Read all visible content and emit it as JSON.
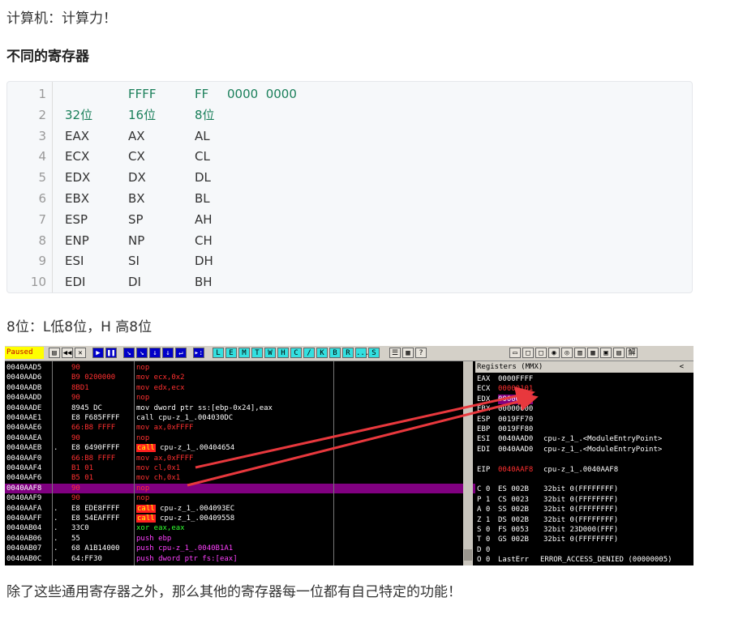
{
  "intro": "计算机：计算力！",
  "heading": "不同的寄存器",
  "code": {
    "line_numbers": [
      "1",
      "2",
      "3",
      "4",
      "5",
      "6",
      "7",
      "8",
      "9",
      "10"
    ],
    "rows": [
      {
        "c1": "",
        "c2": "FFFF",
        "c3": "FF",
        "c4": "0000  0000"
      },
      {
        "c1": "32位",
        "c2": "16位",
        "c3": "8位",
        "c4": ""
      },
      {
        "c1": "EAX",
        "c2": "AX",
        "c3": "AL",
        "c4": ""
      },
      {
        "c1": "ECX",
        "c2": "CX",
        "c3": "CL",
        "c4": ""
      },
      {
        "c1": "EDX",
        "c2": "DX",
        "c3": "DL",
        "c4": ""
      },
      {
        "c1": "EBX",
        "c2": "BX",
        "c3": "BL",
        "c4": ""
      },
      {
        "c1": "ESP",
        "c2": "SP",
        "c3": "AH",
        "c4": ""
      },
      {
        "c1": "ENP",
        "c2": "NP",
        "c3": "CH",
        "c4": ""
      },
      {
        "c1": "ESI",
        "c2": "SI",
        "c3": "DH",
        "c4": ""
      },
      {
        "c1": "EDI",
        "c2": "DI",
        "c3": "BH",
        "c4": ""
      }
    ]
  },
  "note": "8位：L低8位，H 高8位",
  "debugger": {
    "status": "Paused",
    "toolbar_left": [
      "▤",
      "◀◀",
      "✕",
      "▶",
      "❚❚",
      "↘",
      "↘",
      "↓",
      "↓",
      "↵",
      "▸:"
    ],
    "toolbar_letters": [
      "L",
      "E",
      "M",
      "T",
      "W",
      "H",
      "C",
      "/",
      "K",
      "B",
      "R",
      "...",
      "S"
    ],
    "toolbar_misc": [
      "☰",
      "▦",
      "?"
    ],
    "toolbar_right": [
      "▭",
      "□",
      "□",
      "◉",
      "◎",
      "▥",
      "▦",
      "▣",
      "▤",
      "解"
    ],
    "disasm": [
      {
        "addr": "0040AAD5",
        "dot": "",
        "hex": "90",
        "ins": "nop",
        "style": "red"
      },
      {
        "addr": "0040AAD6",
        "dot": "",
        "hex": "B9 0200000",
        "ins": "mov ecx,0x2",
        "style": "red"
      },
      {
        "addr": "0040AADB",
        "dot": "",
        "hex": "8BD1",
        "ins": "mov edx,ecx",
        "style": "red"
      },
      {
        "addr": "0040AADD",
        "dot": "",
        "hex": "90",
        "ins": "nop",
        "style": "red"
      },
      {
        "addr": "0040AADE",
        "dot": "",
        "hex": "8945 DC",
        "ins": "mov dword ptr ss:[ebp-0x24],eax",
        "style": "plain"
      },
      {
        "addr": "0040AAE1",
        "dot": "",
        "hex": "E8 F685FFFF",
        "ins": "call cpu-z_1_.004030DC",
        "style": "plain"
      },
      {
        "addr": "0040AAE6",
        "dot": "",
        "hex": "66:B8 FFFF",
        "ins": "mov ax,0xFFFF",
        "style": "red"
      },
      {
        "addr": "0040AAEA",
        "dot": "",
        "hex": "90",
        "ins": "nop",
        "style": "red"
      },
      {
        "addr": "0040AAEB",
        "dot": ".",
        "hex": "E8 6490FFFF",
        "ins": "cpu-z_1_.00404654",
        "call": "call",
        "style": "call"
      },
      {
        "addr": "0040AAF0",
        "dot": "",
        "hex": "66:B8 FFFF",
        "ins": "mov ax,0xFFFF",
        "style": "red"
      },
      {
        "addr": "0040AAF4",
        "dot": "",
        "hex": "B1 01",
        "ins": "mov cl,0x1",
        "style": "red"
      },
      {
        "addr": "0040AAF6",
        "dot": "",
        "hex": "B5 01",
        "ins": "mov ch,0x1",
        "style": "red"
      },
      {
        "addr": "0040AAF8",
        "dot": "",
        "hex": "90",
        "ins": "nop",
        "style": "sel"
      },
      {
        "addr": "0040AAF9",
        "dot": "",
        "hex": "90",
        "ins": "nop",
        "style": "red"
      },
      {
        "addr": "0040AAFA",
        "dot": ".",
        "hex": "E8 EDE8FFFF",
        "ins": "cpu-z_1_.004093EC",
        "call": "call",
        "style": "call"
      },
      {
        "addr": "0040AAFF",
        "dot": ".",
        "hex": "E8 54EAFFFF",
        "ins": "cpu-z_1_.00409558",
        "call": "call",
        "style": "call"
      },
      {
        "addr": "0040AB04",
        "dot": ".",
        "hex": "33C0",
        "ins": "xor eax,eax",
        "style": "grn"
      },
      {
        "addr": "0040AB06",
        "dot": ".",
        "hex": "55",
        "ins": "push ebp",
        "style": "mag"
      },
      {
        "addr": "0040AB07",
        "dot": ".",
        "hex": "68 A1B14000",
        "ins": "push cpu-z_1_.0040B1A1",
        "style": "magplain"
      },
      {
        "addr": "0040AB0C",
        "dot": ".",
        "hex": "64:FF30",
        "ins": "push dword ptr fs:[eax]",
        "style": "mag"
      }
    ],
    "registers_title": "Registers (MMX)",
    "registers_arrow": "<",
    "registers": [
      {
        "k": "EAX",
        "v": "0000FFFF",
        "d": ""
      },
      {
        "k": "ECX",
        "v": "00000101",
        "d": "",
        "vstyle": "red"
      },
      {
        "k": "EDX",
        "v": "00000000",
        "d": "",
        "vstyle": "hl"
      },
      {
        "k": "EBX",
        "v": "00000000",
        "d": ""
      },
      {
        "k": "ESP",
        "v": "0019FF70",
        "d": ""
      },
      {
        "k": "EBP",
        "v": "0019FF80",
        "d": ""
      },
      {
        "k": "ESI",
        "v": "0040AAD0",
        "d": "cpu-z_1_.<ModuleEntryPoint>"
      },
      {
        "k": "EDI",
        "v": "0040AAD0",
        "d": "cpu-z_1_.<ModuleEntryPoint>"
      },
      {
        "k": "",
        "v": "",
        "d": ""
      },
      {
        "k": "EIP",
        "v": "0040AAF8",
        "d": "cpu-z_1_.0040AAF8",
        "vstyle": "red"
      },
      {
        "k": "",
        "v": "",
        "d": ""
      },
      {
        "k": "C 0",
        "v": "ES 002B",
        "d": "32bit 0(FFFFFFFF)"
      },
      {
        "k": "P 1",
        "v": "CS 0023",
        "d": "32bit 0(FFFFFFFF)"
      },
      {
        "k": "A 0",
        "v": "SS 002B",
        "d": "32bit 0(FFFFFFFF)"
      },
      {
        "k": "Z 1",
        "v": "DS 002B",
        "d": "32bit 0(FFFFFFFF)"
      },
      {
        "k": "S 0",
        "v": "FS 0053",
        "d": "32bit 23D000(FFF)"
      },
      {
        "k": "T 0",
        "v": "GS 002B",
        "d": "32bit 0(FFFFFFFF)"
      },
      {
        "k": "D 0",
        "v": "",
        "d": ""
      },
      {
        "k": "O 0",
        "v": "LastErr",
        "d": "ERROR_ACCESS_DENIED (00000005)"
      }
    ],
    "arrow_color": "#e8383d"
  },
  "closing": "除了这些通用寄存器之外，那么其他的寄存器每一位都有自己特定的功能！"
}
